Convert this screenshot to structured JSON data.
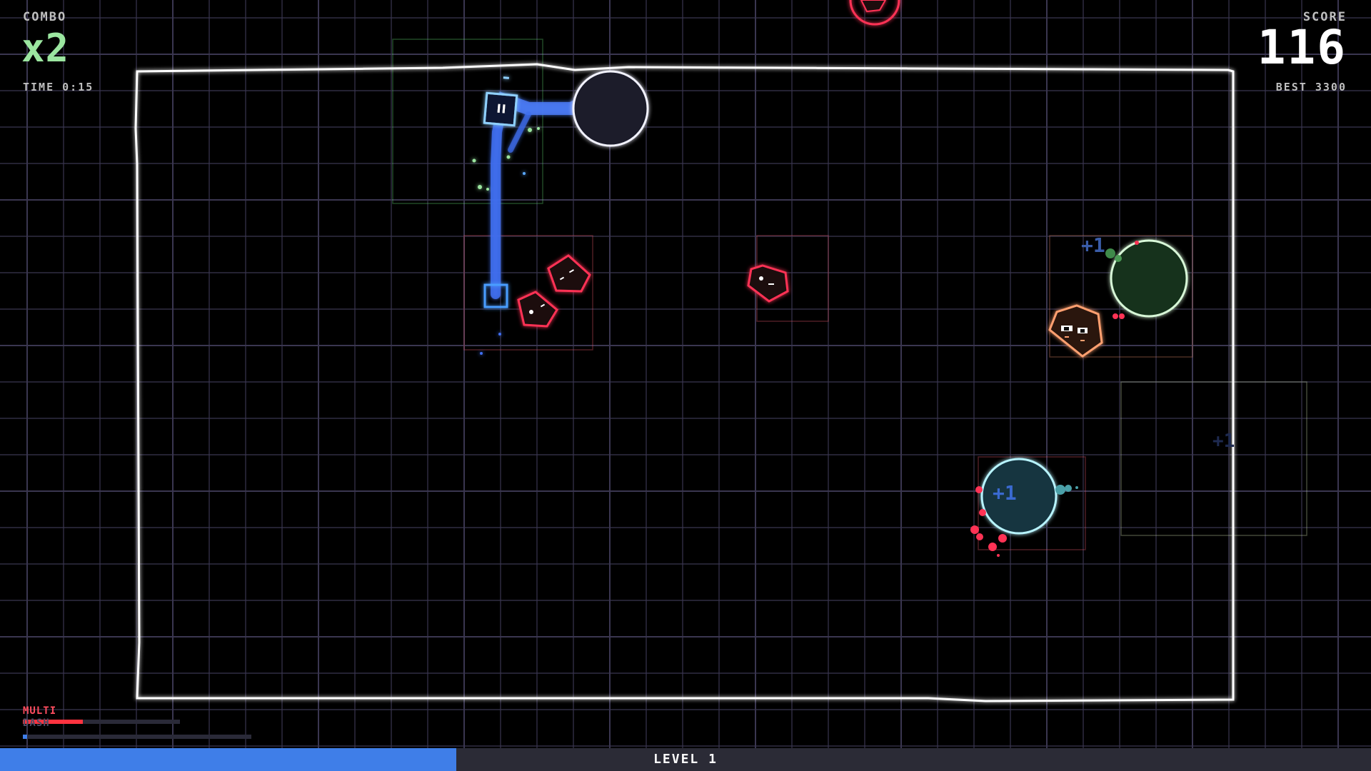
{
  "hud": {
    "combo_label": "COMBO",
    "combo_value": "x2",
    "time_label": "TIME 0:15",
    "score_label": "SCORE",
    "score_value": "116",
    "best_label": "BEST 3300",
    "multi_label": "MULTI",
    "dash_label": "DASH",
    "multi_meter_fraction": 0.38,
    "dash_meter_fraction": 0.02,
    "level_label": "LEVEL 1",
    "level_progress_fraction": 0.333
  },
  "popups": {
    "plus_one": "+1"
  },
  "colors": {
    "arena_border": "#ffffff",
    "grid": "#3a3650",
    "player": "#5aa8ff",
    "trail": "#3f6ef0",
    "enemy_red": "#ff3355",
    "enemy_orange": "#ff9966",
    "orb_white": "#ffffff",
    "orb_green": "#bff0c0",
    "orb_cyan": "#a8f0ff",
    "combo": "#9be6a0",
    "multi_meter": "#ff3340",
    "dash_meter": "#3f7ee8",
    "level_fill": "#3f7ee8"
  }
}
